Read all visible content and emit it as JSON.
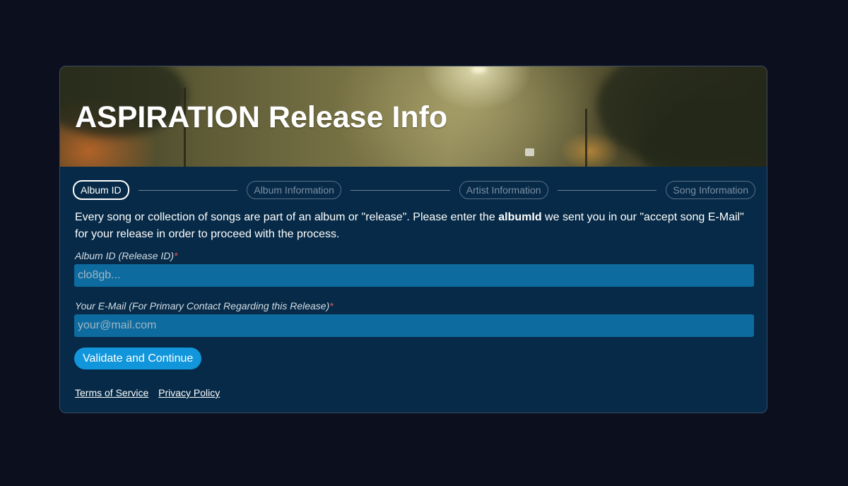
{
  "header": {
    "title": "ASPIRATION Release Info"
  },
  "steps": [
    {
      "label": "Album ID",
      "active": true
    },
    {
      "label": "Album Information",
      "active": false
    },
    {
      "label": "Artist Information",
      "active": false
    },
    {
      "label": "Song Information",
      "active": false
    }
  ],
  "intro": {
    "before": "Every song or collection of songs are part of an album or \"release\". Please enter the ",
    "bold": "albumId",
    "after": " we sent you in our \"accept song E-Mail\" for your release in order to proceed with the process."
  },
  "form": {
    "album_id": {
      "label": "Album ID (Release ID)",
      "required_mark": "*",
      "placeholder": "clo8gb...",
      "value": ""
    },
    "email": {
      "label": "Your E-Mail (For Primary Contact Regarding this Release)",
      "required_mark": "*",
      "placeholder": "your@mail.com",
      "value": ""
    },
    "submit_label": "Validate and Continue"
  },
  "footer": {
    "terms": "Terms of Service",
    "privacy": "Privacy Policy"
  },
  "colors": {
    "page_background": "#0b0f1e",
    "card_background": "#062a47",
    "input_background": "#0e6b9f",
    "button_background": "#1296db",
    "required": "#e05656"
  }
}
